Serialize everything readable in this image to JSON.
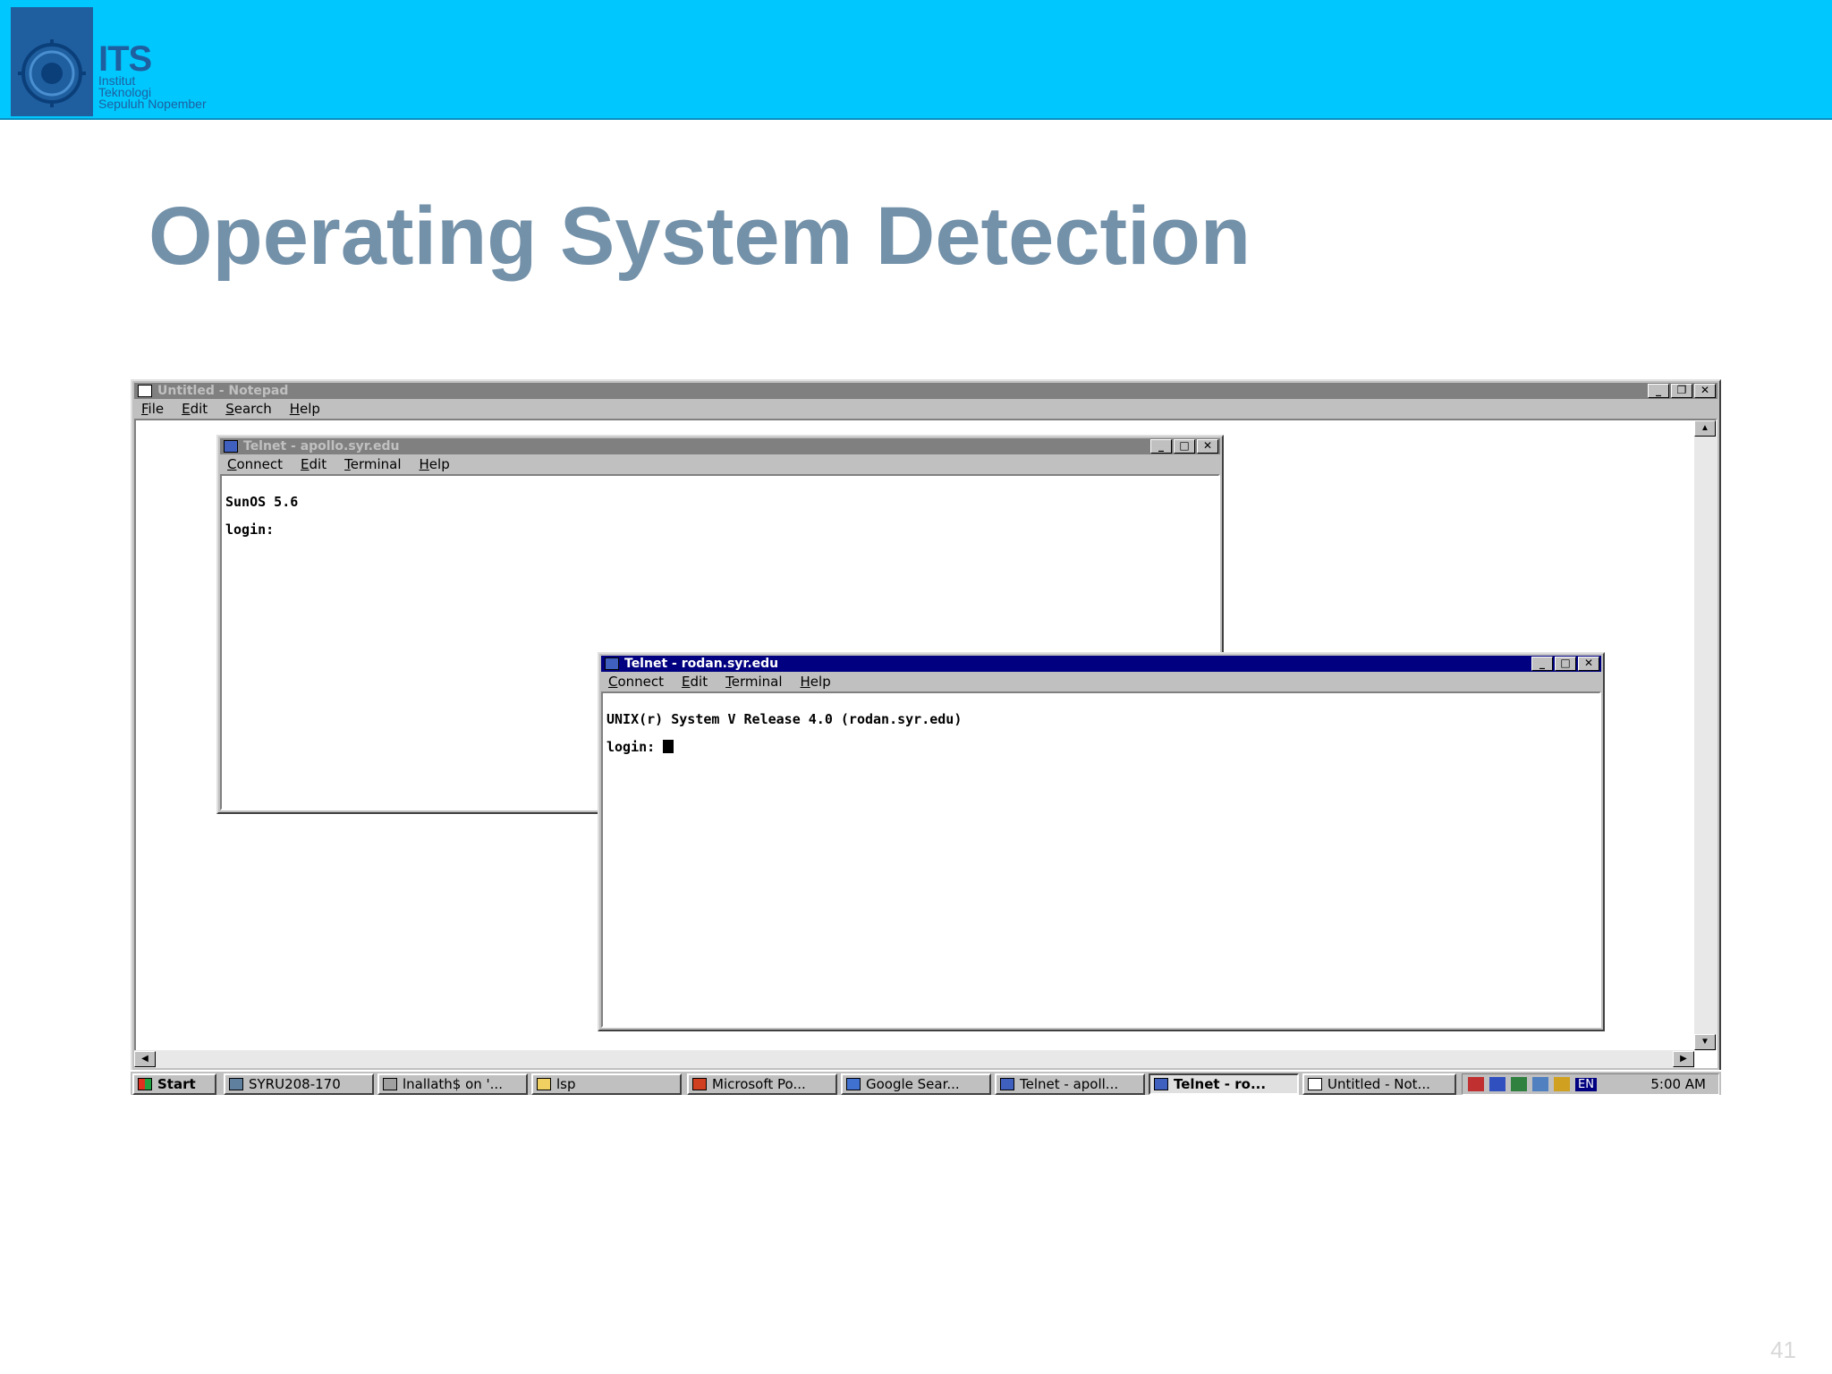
{
  "slide": {
    "title": "Operating System Detection",
    "page_number": "41",
    "logo": {
      "abbr": "ITS",
      "line1": "Institut",
      "line2": "Teknologi",
      "line3": "Sepuluh Nopember"
    }
  },
  "notepad": {
    "title": "Untitled - Notepad",
    "menu": [
      "File",
      "Edit",
      "Search",
      "Help"
    ]
  },
  "telnet_apollo": {
    "title": "Telnet - apollo.syr.edu",
    "menu": [
      "Connect",
      "Edit",
      "Terminal",
      "Help"
    ],
    "lines": [
      "SunOS 5.6",
      "login:"
    ]
  },
  "telnet_rodan": {
    "title": "Telnet - rodan.syr.edu",
    "menu": [
      "Connect",
      "Edit",
      "Terminal",
      "Help"
    ],
    "lines": [
      "UNIX(r) System V Release 4.0 (rodan.syr.edu)",
      "login: "
    ]
  },
  "taskbar": {
    "start_label": "Start",
    "buttons": [
      "SYRU208-170",
      "lnallath$ on '...",
      "lsp",
      "Microsoft Po...",
      "Google Sear...",
      "Telnet - apoll...",
      "Telnet - ro...",
      "Untitled - Not..."
    ],
    "active_button_index": 6,
    "tray_language": "EN",
    "clock": "5:00 AM"
  },
  "colors": {
    "header_band": "#00c8fe",
    "title_text": "#7391a9",
    "active_titlebar": "#000080",
    "inactive_titlebar": "#808080"
  }
}
